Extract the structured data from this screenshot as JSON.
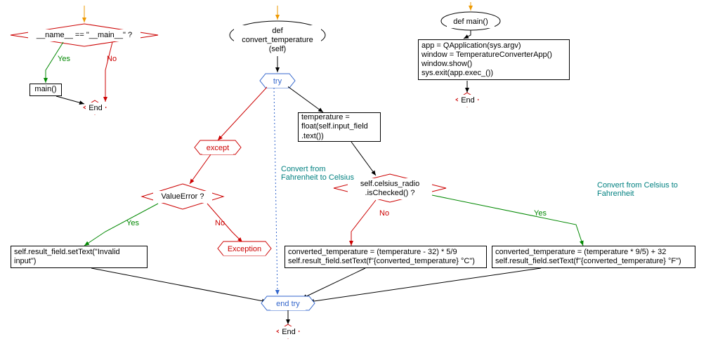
{
  "flow1": {
    "entry_arrow": "entry",
    "decision": "__name__ == \"__main__\" ?",
    "yes": "Yes",
    "no": "No",
    "main_call": "main()",
    "end": "End"
  },
  "flow2": {
    "func_def": "def convert_temperature\n(self)",
    "try": "try",
    "except": "except",
    "value_error": "ValueError ?",
    "yes": "Yes",
    "no": "No",
    "invalid": "self.result_field.setText(\"Invalid\ninput\")",
    "exception": "Exception",
    "temp_assign": "temperature =\nfloat(self.input_field\n.text())",
    "is_checked": "self.celsius_radio\n.isChecked() ?",
    "comment_f2c": "Convert from\nFahrenheit to Celsius",
    "comment_c2f": "Convert from Celsius\nto Fahrenheit",
    "f2c_block": "converted_temperature = (temperature - 32) * 5/9\nself.result_field.setText(f\"{converted_temperature} °C\")",
    "c2f_block": "converted_temperature = (temperature * 9/5) + 32\nself.result_field.setText(f\"{converted_temperature} °F\")",
    "end_try": "end try",
    "end": "End"
  },
  "flow3": {
    "func_def": "def main()",
    "body": "app = QApplication(sys.argv)\nwindow = TemperatureConverterApp()\nwindow.show()\nsys.exit(app.exec_())",
    "end": "End"
  }
}
